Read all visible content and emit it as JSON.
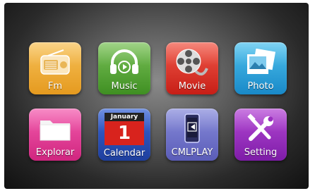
{
  "apps": {
    "fm": "Fm",
    "music": "Music",
    "movie": "Movie",
    "photo": "Photo",
    "explorar": "Explorar",
    "calendar": "Calendar",
    "calendar_month": "January",
    "calendar_day": "1",
    "cmlplay": "CMLPLAY",
    "setting": "Setting"
  },
  "icons": {
    "fm": "radio-icon",
    "music": "headphones-icon",
    "movie": "film-reel-icon",
    "photo": "photos-icon",
    "explorar": "folder-icon",
    "calendar": "calendar-icon",
    "cmlplay": "phone-mirror-icon",
    "setting": "tools-icon"
  },
  "colors": {
    "fm": "#e59a1f",
    "music": "#3f8f22",
    "movie": "#c71e16",
    "photo": "#1989c8",
    "explorar": "#d0257f",
    "calendar": "#1e3f9e",
    "cmlplay": "#5a5cb8",
    "setting": "#7e1ca8"
  }
}
